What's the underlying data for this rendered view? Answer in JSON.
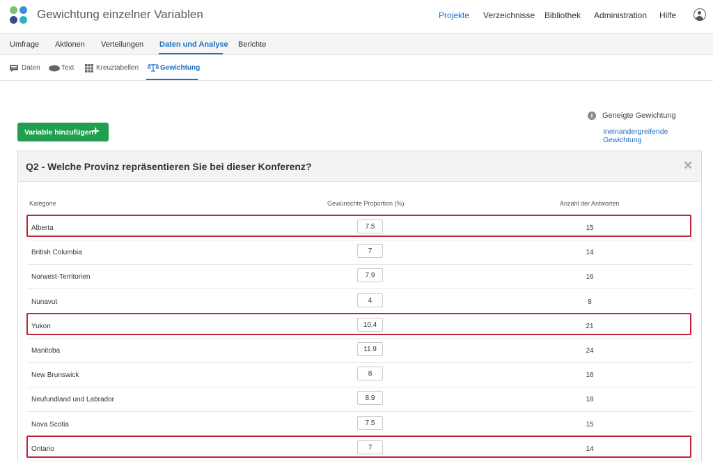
{
  "header": {
    "project_title": "Gewichtung einzelner Variablen",
    "nav": [
      "Projekte",
      "Verzeichnisse",
      "Bibliothek",
      "Administration",
      "Hilfe"
    ],
    "active_nav": "Projekte"
  },
  "subnav": {
    "tabs": [
      "Umfrage",
      "Aktionen",
      "Verteilungen",
      "Daten und Analyse",
      "Berichte"
    ],
    "active": "Daten und Analyse"
  },
  "toolbar": {
    "items": [
      "Daten",
      "Text",
      "Kreuztabellen",
      "Gewichtung"
    ],
    "active": "Gewichtung"
  },
  "side_info": {
    "label": "Geneigte Gewichtung",
    "link": "Ineinandergreifende Gewichtung"
  },
  "add_button": {
    "label": "Variable hinzufügen"
  },
  "panel": {
    "question": "Q2 - Welche Provinz repräsentieren Sie bei dieser Konferenz?",
    "columns": [
      "Kategorie",
      "Gewünschte Proportion (%)",
      "Anzahl der Antworten"
    ],
    "rows": [
      {
        "category": "Alberta",
        "proportion": "7.5",
        "count": "15",
        "highlighted": true
      },
      {
        "category": "British Columbia",
        "proportion": "7",
        "count": "14",
        "highlighted": false
      },
      {
        "category": "Norwest-Territorien",
        "proportion": "7.9",
        "count": "16",
        "highlighted": false
      },
      {
        "category": "Nunavut",
        "proportion": "4",
        "count": "8",
        "highlighted": false
      },
      {
        "category": "Yukon",
        "proportion": "10.4",
        "count": "21",
        "highlighted": true
      },
      {
        "category": "Manitoba",
        "proportion": "11.9",
        "count": "24",
        "highlighted": false
      },
      {
        "category": "New Brunswick",
        "proportion": "8",
        "count": "16",
        "highlighted": false
      },
      {
        "category": "Neufundland und Labrador",
        "proportion": "8.9",
        "count": "18",
        "highlighted": false
      },
      {
        "category": "Nova Scotia",
        "proportion": "7.5",
        "count": "15",
        "highlighted": false
      },
      {
        "category": "Ontario",
        "proportion": "7",
        "count": "14",
        "highlighted": true
      }
    ]
  },
  "colors": {
    "accent": "#1a6fc4",
    "button": "#1f9f4f",
    "highlight": "#c4213a"
  }
}
